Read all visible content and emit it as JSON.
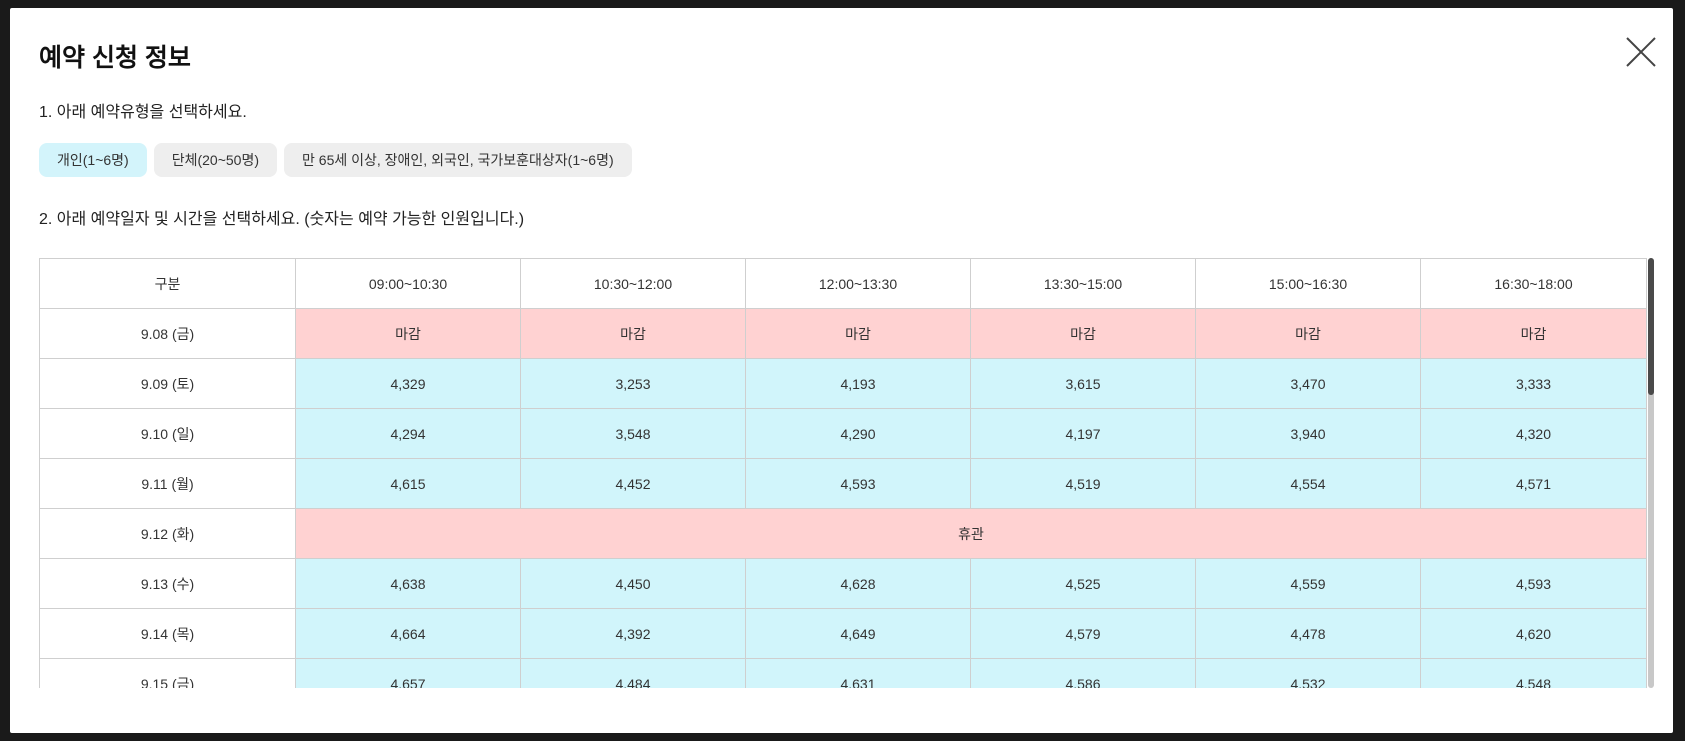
{
  "modal": {
    "title": "예약 신청 정보",
    "step1_label": "1. 아래 예약유형을 선택하세요.",
    "step2_label": "2. 아래 예약일자 및 시간을 선택하세요. (숫자는 예약 가능한 인원입니다.)"
  },
  "reservation_types": [
    {
      "label": "개인(1~6명)",
      "selected": true
    },
    {
      "label": "단체(20~50명)",
      "selected": false
    },
    {
      "label": "만 65세 이상, 장애인, 외국인, 국가보훈대상자(1~6명)",
      "selected": false
    }
  ],
  "schedule": {
    "header": [
      "구분",
      "09:00~10:30",
      "10:30~12:00",
      "12:00~13:30",
      "13:30~15:00",
      "15:00~16:30",
      "16:30~18:00"
    ],
    "rows": [
      {
        "date": "9.08 (금)",
        "status": "closed",
        "cells": [
          "마감",
          "마감",
          "마감",
          "마감",
          "마감",
          "마감"
        ]
      },
      {
        "date": "9.09 (토)",
        "status": "open",
        "cells": [
          "4,329",
          "3,253",
          "4,193",
          "3,615",
          "3,470",
          "3,333"
        ]
      },
      {
        "date": "9.10 (일)",
        "status": "open",
        "cells": [
          "4,294",
          "3,548",
          "4,290",
          "4,197",
          "3,940",
          "4,320"
        ]
      },
      {
        "date": "9.11 (월)",
        "status": "open",
        "cells": [
          "4,615",
          "4,452",
          "4,593",
          "4,519",
          "4,554",
          "4,571"
        ]
      },
      {
        "date": "9.12 (화)",
        "status": "holiday",
        "note": "휴관"
      },
      {
        "date": "9.13 (수)",
        "status": "open",
        "cells": [
          "4,638",
          "4,450",
          "4,628",
          "4,525",
          "4,559",
          "4,593"
        ]
      },
      {
        "date": "9.14 (목)",
        "status": "open",
        "cells": [
          "4,664",
          "4,392",
          "4,649",
          "4,579",
          "4,478",
          "4,620"
        ]
      },
      {
        "date": "9.15 (금)",
        "status": "open",
        "cells": [
          "4,657",
          "4,484",
          "4,631",
          "4,586",
          "4,532",
          "4,548"
        ]
      }
    ]
  },
  "colors": {
    "closed_bg": "#ffd2d2",
    "open_bg": "#d1f5fb",
    "selected_type_bg": "#d3f4fb",
    "type_bg": "#eeeeee"
  }
}
